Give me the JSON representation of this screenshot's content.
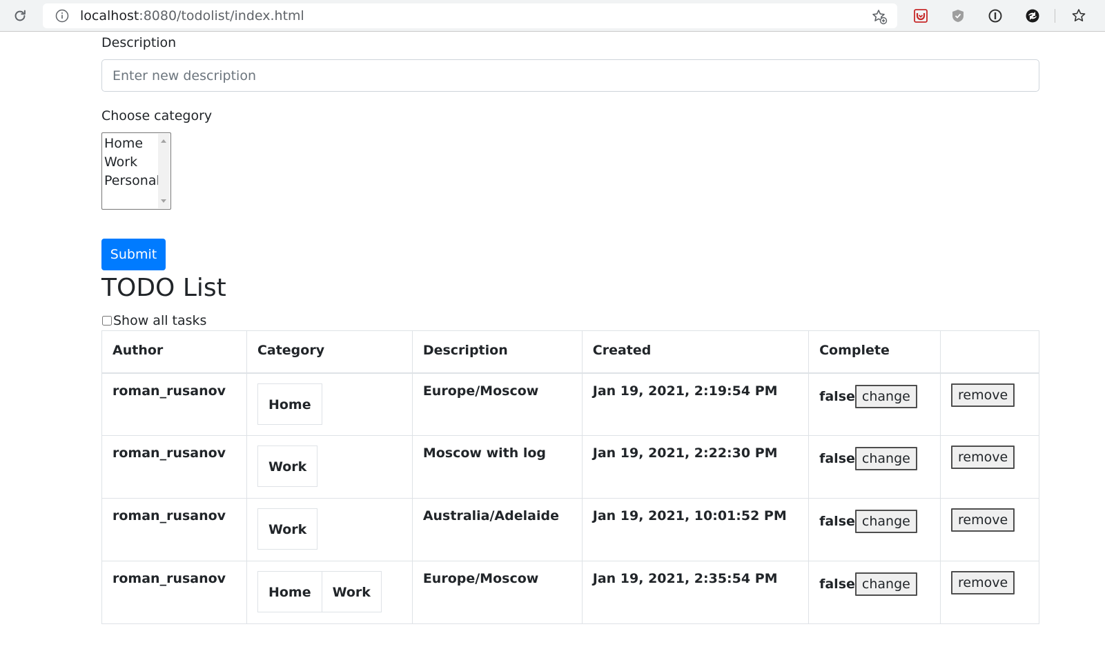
{
  "browser": {
    "url_host": "localhost",
    "url_rest": ":8080/todolist/index.html"
  },
  "form": {
    "description_label": "Description",
    "description_placeholder": "Enter new description",
    "description_value": "",
    "category_label": "Choose category",
    "category_options": [
      "Home",
      "Work",
      "Personal"
    ],
    "submit_label": "Submit"
  },
  "list": {
    "title": "TODO List",
    "show_all_label": "Show all tasks",
    "show_all_checked": false,
    "headers": [
      "Author",
      "Category",
      "Description",
      "Created",
      "Complete",
      ""
    ],
    "rows": [
      {
        "author": "roman_rusanov",
        "categories": [
          "Home"
        ],
        "description": "Europe/Moscow",
        "created": "Jan 19, 2021, 2:19:54 PM",
        "complete": "false",
        "change_label": "change",
        "remove_label": "remove"
      },
      {
        "author": "roman_rusanov",
        "categories": [
          "Work"
        ],
        "description": "Moscow with log",
        "created": "Jan 19, 2021, 2:22:30 PM",
        "complete": "false",
        "change_label": "change",
        "remove_label": "remove"
      },
      {
        "author": "roman_rusanov",
        "categories": [
          "Work"
        ],
        "description": "Australia/Adelaide",
        "created": "Jan 19, 2021, 10:01:52 PM",
        "complete": "false",
        "change_label": "change",
        "remove_label": "remove"
      },
      {
        "author": "roman_rusanov",
        "categories": [
          "Home",
          "Work"
        ],
        "description": "Europe/Moscow",
        "created": "Jan 19, 2021, 2:35:54 PM",
        "complete": "false",
        "change_label": "change",
        "remove_label": "remove"
      }
    ]
  },
  "colors": {
    "primary": "#007bff",
    "text": "#212529",
    "border": "#dee2e6"
  }
}
